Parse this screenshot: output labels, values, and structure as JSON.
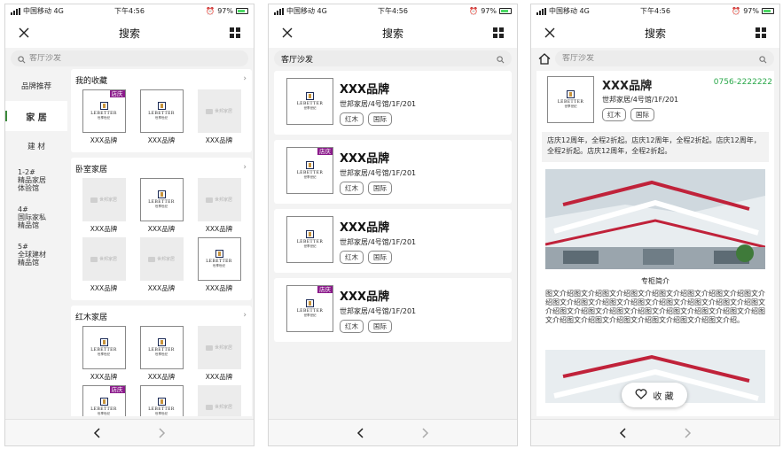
{
  "status": {
    "carrier": "中国移动 4G",
    "time": "下午4:56",
    "battery": "97%"
  },
  "nav": {
    "title": "搜索"
  },
  "search": {
    "placeholder": "客厅沙发",
    "value": "客厅沙发"
  },
  "sidebar": {
    "items": [
      {
        "label": "品牌推荐"
      },
      {
        "label": "家 居"
      },
      {
        "label": "建 材"
      },
      {
        "label": "1-2#\n精品家居\n体验馆"
      },
      {
        "label": "4#\n国际家私\n精品馆"
      },
      {
        "label": "5#\n全球建材\n精品馆"
      }
    ]
  },
  "sections": [
    {
      "title": "我的收藏",
      "items": [
        {
          "name": "XXX品牌",
          "kind": "logo",
          "badge": "店庆"
        },
        {
          "name": "XXX品牌",
          "kind": "logo",
          "badge": ""
        },
        {
          "name": "XXX品牌",
          "kind": "gray",
          "badge": ""
        }
      ]
    },
    {
      "title": "卧室家居",
      "items": [
        {
          "name": "XXX品牌",
          "kind": "gray",
          "badge": ""
        },
        {
          "name": "XXX品牌",
          "kind": "logo",
          "badge": ""
        },
        {
          "name": "XXX品牌",
          "kind": "gray",
          "badge": ""
        },
        {
          "name": "XXX品牌",
          "kind": "gray",
          "badge": ""
        },
        {
          "name": "XXX品牌",
          "kind": "gray",
          "badge": ""
        },
        {
          "name": "XXX品牌",
          "kind": "logo",
          "badge": ""
        }
      ]
    },
    {
      "title": "红木家居",
      "items": [
        {
          "name": "XXX品牌",
          "kind": "logo",
          "badge": ""
        },
        {
          "name": "XXX品牌",
          "kind": "logo",
          "badge": ""
        },
        {
          "name": "XXX品牌",
          "kind": "gray",
          "badge": ""
        },
        {
          "name": "",
          "kind": "logo",
          "badge": "店庆"
        },
        {
          "name": "",
          "kind": "logo",
          "badge": ""
        },
        {
          "name": "",
          "kind": "gray",
          "badge": ""
        }
      ]
    }
  ],
  "logo": {
    "wordmark": "LEBETTER",
    "sub": "世享世纪",
    "gray_text": "世邦家居"
  },
  "results": [
    {
      "name": "XXX品牌",
      "address": "世邦家居/4号馆/1F/201",
      "tags": [
        "红木",
        "国际"
      ],
      "badge": ""
    },
    {
      "name": "XXX品牌",
      "address": "世邦家居/4号馆/1F/201",
      "tags": [
        "红木",
        "国际"
      ],
      "badge": "店庆"
    },
    {
      "name": "XXX品牌",
      "address": "世邦家居/4号馆/1F/201",
      "tags": [
        "红木",
        "国际"
      ],
      "badge": ""
    },
    {
      "name": "XXX品牌",
      "address": "世邦家居/4号馆/1F/201",
      "tags": [
        "红木",
        "国际"
      ],
      "badge": "店庆"
    }
  ],
  "detail": {
    "name": "XXX品牌",
    "address": "世邦家居/4号馆/1F/201",
    "tags": [
      "红木",
      "国际"
    ],
    "phone": "0756-2222222",
    "promo": "店庆12周年，全程2折起。店庆12周年，全程2折起。店庆12周年，全程2折起。店庆12周年，全程2折起。",
    "intro_title": "专柜简介",
    "intro_text": "图文介绍图文介绍图文介绍图文介绍图文介绍图文介绍图文介绍图文介绍图文介绍图文介绍图文介绍图文介绍图文介绍图文介绍图文介绍图文介绍图文介绍图文介绍图文介绍图文介绍图文介绍图文介绍图文介绍图文介绍图文介绍图文介绍图文介绍图文介绍图文介绍图文介绍。",
    "fav_label": "收 藏"
  },
  "icons": {
    "close": "close-icon",
    "grid": "grid-icon",
    "home": "home-icon",
    "search": "search-icon",
    "back": "chevron-left-icon",
    "forward": "chevron-right-icon",
    "heart": "heart-icon"
  },
  "colors": {
    "badge": "#8b1a8b",
    "phone": "#2aa84a",
    "active_indicator": "#3c8a3c"
  }
}
